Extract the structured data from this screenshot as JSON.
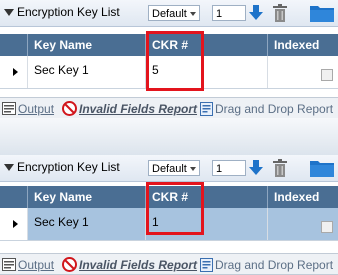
{
  "panels": [
    {
      "title": "Encryption Key List",
      "filter_select": "Default",
      "page_value": "1",
      "columns": [
        "Key Name",
        "CKR #",
        "Indexed"
      ],
      "row": {
        "key_name": "Sec Key 1",
        "ckr": "5",
        "selected": false
      }
    },
    {
      "title": "Encryption Key List",
      "filter_select": "Default",
      "page_value": "1",
      "columns": [
        "Key Name",
        "CKR #",
        "Indexed"
      ],
      "row": {
        "key_name": "Sec Key 1",
        "ckr": "1",
        "selected": true
      }
    }
  ],
  "tabs": {
    "output": "Output",
    "invalid_fields": "Invalid Fields Report",
    "drag_drop": "Drag and Drop Report"
  },
  "colors": {
    "header_bg": "#4a6e93",
    "selected_row_bg": "#a7c3df",
    "highlight": "#e3141d",
    "accent_blue": "#1e73c9"
  },
  "icons": [
    "collapse-triangle-icon",
    "download-arrow-icon",
    "trash-icon",
    "folder-icon",
    "output-icon",
    "no-entry-icon",
    "report-icon"
  ]
}
